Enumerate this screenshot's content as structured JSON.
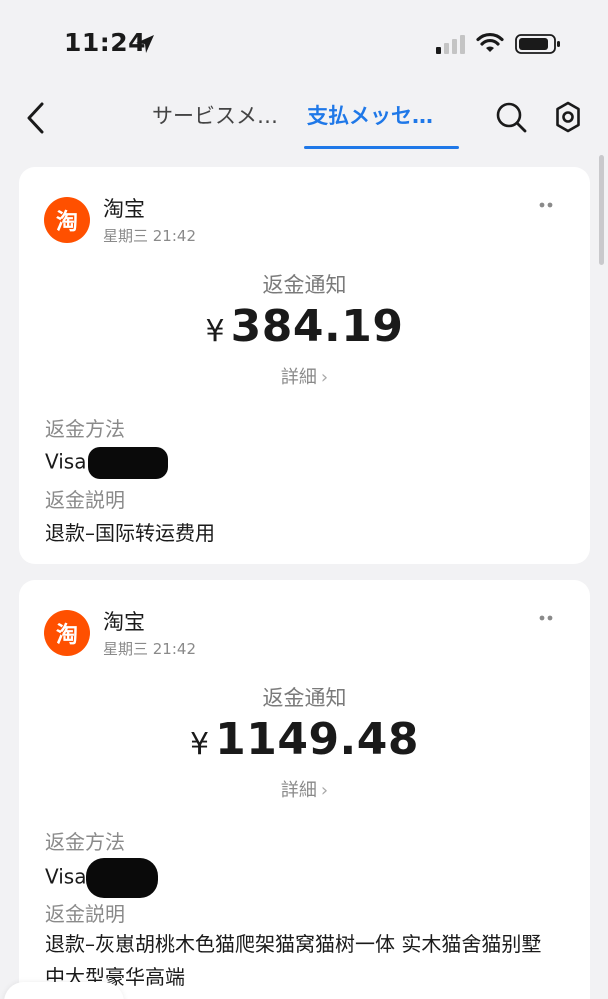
{
  "status_bar": {
    "time": "11:24"
  },
  "nav": {
    "tabs": [
      {
        "label": "サービスメ…",
        "active": false
      },
      {
        "label": "支払メッセ…",
        "active": true
      }
    ],
    "accent_color": "#1f78e8"
  },
  "messages": [
    {
      "app_logo_text": "淘",
      "app_name": "淘宝",
      "time": "星期三 21:42",
      "notice_title": "返金通知",
      "currency": "¥",
      "amount": "384.19",
      "detail_label": "詳細",
      "method_label": "返金方法",
      "method_value": "Visa(",
      "desc_label": "返金説明",
      "desc_value": "退款–国际转运费用"
    },
    {
      "app_logo_text": "淘",
      "app_name": "淘宝",
      "time": "星期三 21:42",
      "notice_title": "返金通知",
      "currency": "¥",
      "amount": "1149.48",
      "detail_label": "詳細",
      "method_label": "返金方法",
      "method_value": "Visa(",
      "desc_label": "返金説明",
      "desc_value": "退款–灰崽胡桃木色猫爬架猫窝猫树一体 实木猫舍猫别墅 中大型豪华高端"
    }
  ],
  "colors": {
    "brand_taobao": "#ff5000",
    "background": "#f2f2f4"
  }
}
